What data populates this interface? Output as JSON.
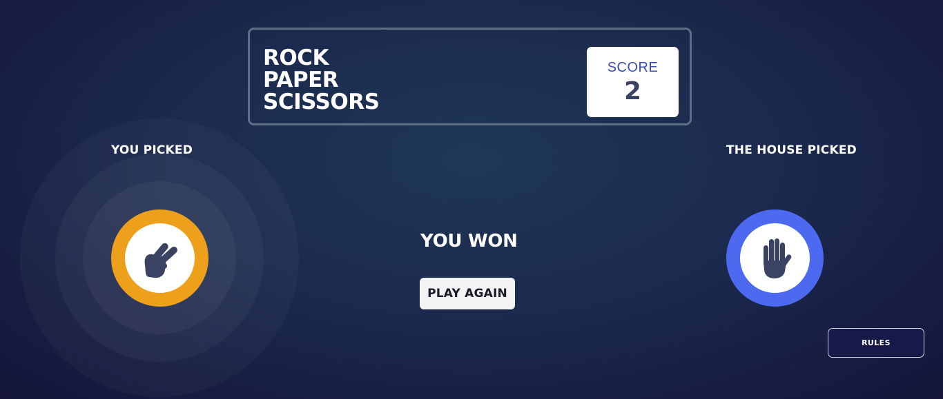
{
  "header": {
    "title_lines": [
      "ROCK",
      "PAPER",
      "SCISSORS"
    ],
    "score_label": "SCORE",
    "score_value": "2"
  },
  "player": {
    "label": "YOU PICKED",
    "choice": "scissors",
    "icon": "scissors-hand-icon",
    "ring_color": "#eca01b"
  },
  "house": {
    "label": "THE HOUSE PICKED",
    "choice": "paper",
    "icon": "paper-hand-icon",
    "ring_color": "#4d69ef"
  },
  "result": {
    "text": "YOU WON",
    "play_again_label": "PLAY AGAIN"
  },
  "rules_button": {
    "label": "RULES"
  },
  "colors": {
    "background_center": "#1f3756",
    "background_edge": "#141539",
    "score_label": "#3b4cb2",
    "dark_text": "#3b4363",
    "header_border": "#5f6f86",
    "icon_fill": "#3b4363"
  }
}
